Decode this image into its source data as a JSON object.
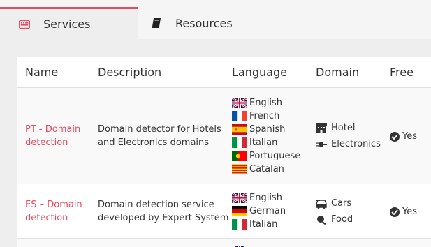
{
  "tabs": [
    {
      "label": "Services",
      "icon": "keyboard-icon",
      "active": true
    },
    {
      "label": "Resources",
      "icon": "book-icon",
      "active": false
    }
  ],
  "table": {
    "headers": {
      "name": "Name",
      "description": "Description",
      "language": "Language",
      "domain": "Domain",
      "free": "Free"
    },
    "rows": [
      {
        "name_line1": "PT - Domain",
        "name_line2": "detection",
        "desc_line1": "Domain detector for Hotels",
        "desc_line2": "and Electronics domains",
        "languages": [
          "English",
          "French",
          "Spanish",
          "Italian",
          "Portuguese",
          "Catalan"
        ],
        "domains": [
          "Hotel",
          "Electronics"
        ],
        "free": "Yes"
      },
      {
        "name_line1": "ES – Domain",
        "name_line2": "detection",
        "desc_line1": "Domain detection service",
        "desc_line2": "developed by Expert System",
        "languages": [
          "English",
          "German",
          "Italian"
        ],
        "domains": [
          "Cars",
          "Food"
        ],
        "free": "Yes"
      }
    ]
  },
  "colors": {
    "accent": "#e84a5f",
    "link": "#e84a5f",
    "text": "#333333"
  }
}
